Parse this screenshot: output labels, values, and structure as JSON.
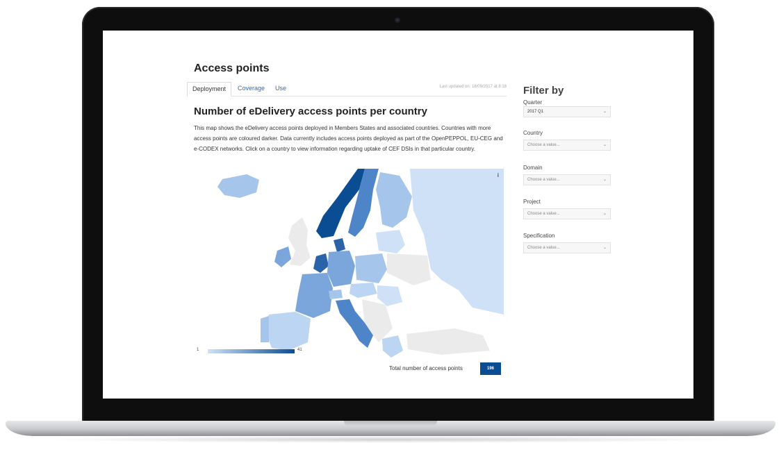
{
  "page": {
    "title": "Access points",
    "last_updated": "Last updated on: 18/09/2017 at 8:18"
  },
  "tabs": [
    {
      "label": "Deployment",
      "active": true
    },
    {
      "label": "Coverage",
      "active": false
    },
    {
      "label": "Use",
      "active": false
    }
  ],
  "main": {
    "heading": "Number of eDelivery access points per country",
    "description": "This map shows the eDelivery access points deployed in Members States and associated countries. Countries with more access points are coloured darker. Data currently includes access points deployed as part of the OpenPEPPOL, EU-CEG and e-CODEX networks. Click on a country to view information regarding uptake of CEF DSIs in that particular country."
  },
  "map": {
    "info_icon": "info-icon",
    "legend": {
      "min": "1",
      "max": "41",
      "color_min": "#cfe1f7",
      "color_max": "#0b4d93"
    },
    "colors": {
      "none": "#ebebeb",
      "level1": "#cfe1f7",
      "level2": "#bcd5f2",
      "level3": "#a5c5ea",
      "level4": "#7aa6dc",
      "level5": "#4e85c8",
      "level6": "#2a63a8",
      "level7": "#0b4d93"
    }
  },
  "total": {
    "label": "Total number of access points",
    "value": "196"
  },
  "filters": {
    "title": "Filter by",
    "items": [
      {
        "label": "Quarter",
        "value": "2017 Q1",
        "filled": true
      },
      {
        "label": "Country",
        "value": "Choose a value...",
        "filled": false
      },
      {
        "label": "Domain",
        "value": "Choose a value...",
        "filled": false
      },
      {
        "label": "Project",
        "value": "Choose a value...",
        "filled": false
      },
      {
        "label": "Specification",
        "value": "Choose a value...",
        "filled": false
      }
    ]
  }
}
